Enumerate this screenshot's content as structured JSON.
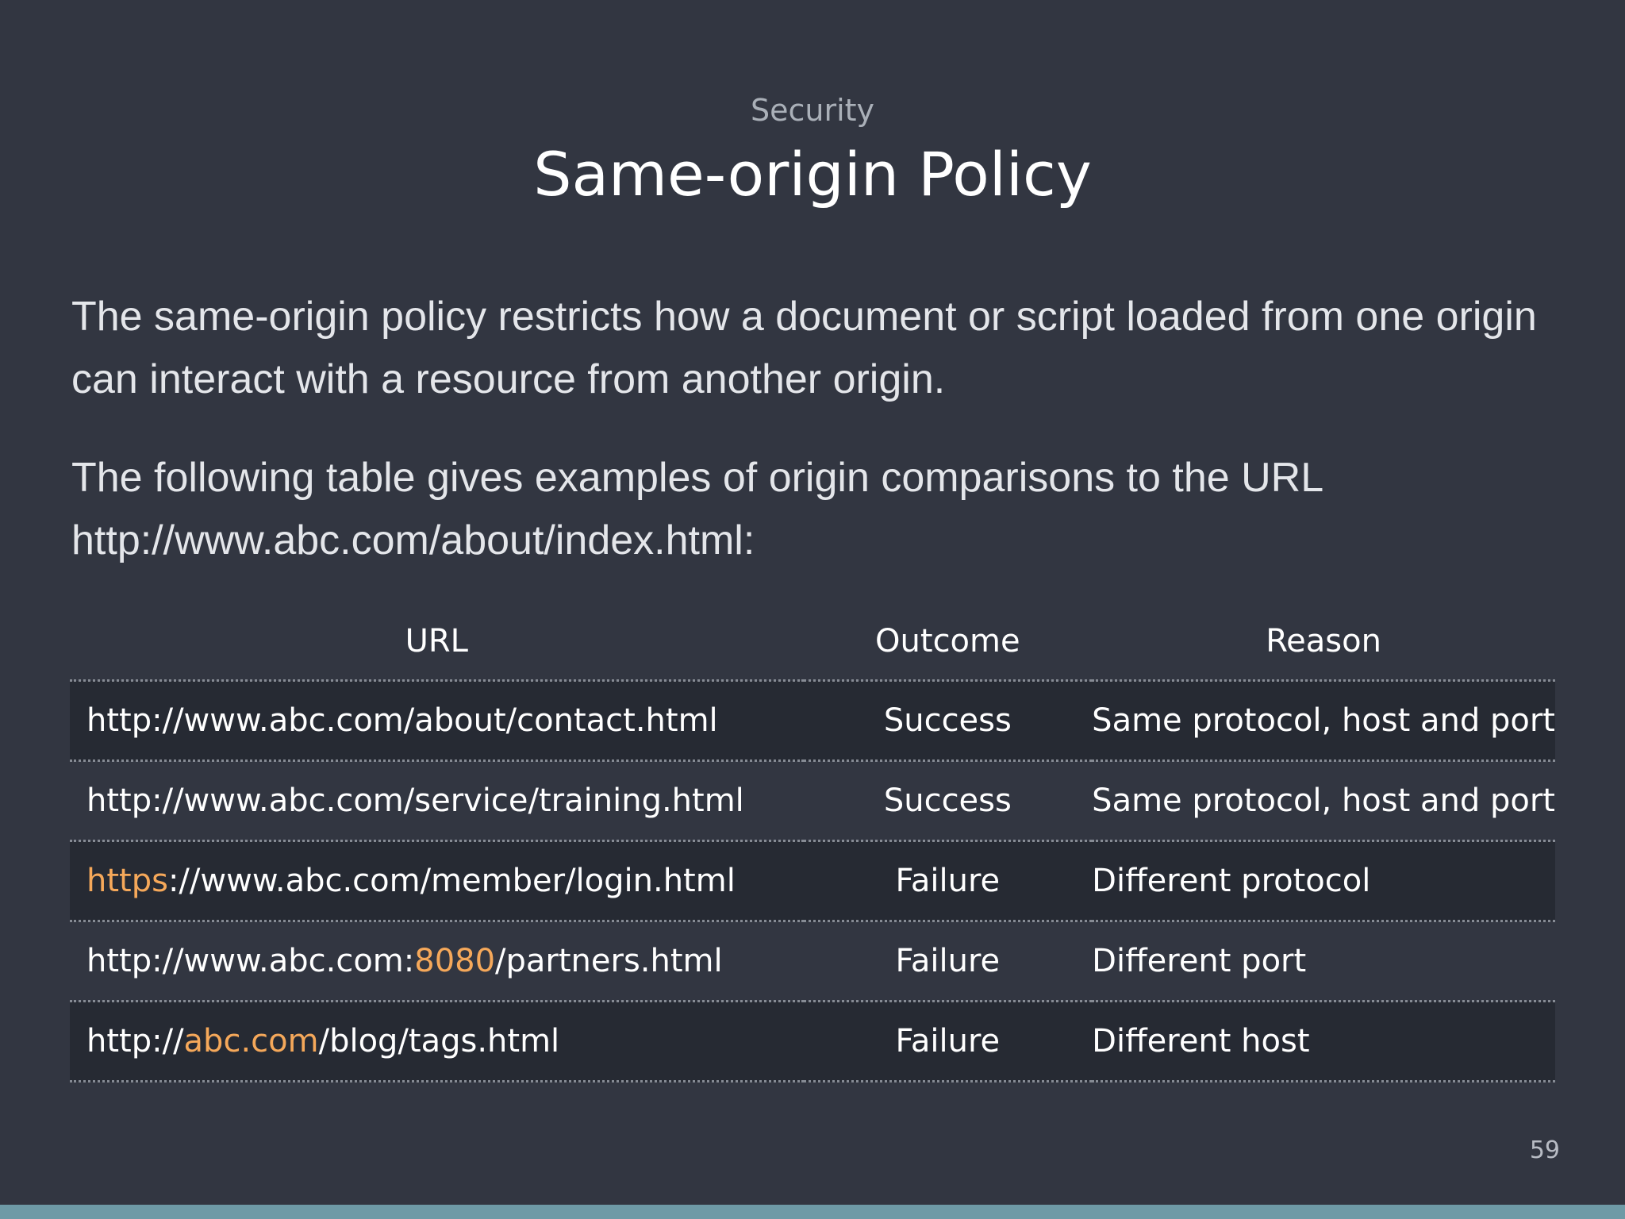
{
  "header": {
    "section": "Security",
    "title": "Same-origin Policy"
  },
  "body": {
    "paragraph_1": "The same-origin policy restricts how a document or script loaded from one origin can interact with a resource from another origin.",
    "paragraph_2": "The following table gives examples of origin comparisons to the URL http://www.abc.com/about/index.html:"
  },
  "table": {
    "columns": [
      "URL",
      "Outcome",
      "Reason"
    ],
    "rows": [
      {
        "url_parts": [
          {
            "text": "http://www.abc.com/about/contact.html",
            "highlight": false
          }
        ],
        "outcome": "Success",
        "reason": "Same protocol, host and port"
      },
      {
        "url_parts": [
          {
            "text": "http://www.abc.com/service/training.html",
            "highlight": false
          }
        ],
        "outcome": "Success",
        "reason": "Same protocol, host and port"
      },
      {
        "url_parts": [
          {
            "text": "https",
            "highlight": true
          },
          {
            "text": "://www.abc.com/member/login.html",
            "highlight": false
          }
        ],
        "outcome": "Failure",
        "reason": "Different protocol"
      },
      {
        "url_parts": [
          {
            "text": "http://www.abc.com:",
            "highlight": false
          },
          {
            "text": "8080",
            "highlight": true
          },
          {
            "text": "/partners.html",
            "highlight": false
          }
        ],
        "outcome": "Failure",
        "reason": "Different port"
      },
      {
        "url_parts": [
          {
            "text": "http://",
            "highlight": false
          },
          {
            "text": "abc.com",
            "highlight": true
          },
          {
            "text": "/blog/tags.html",
            "highlight": false
          }
        ],
        "outcome": "Failure",
        "reason": "Different host"
      }
    ]
  },
  "footer": {
    "page_number": "59"
  },
  "colors": {
    "background": "#323641",
    "row_alt": "#262a33",
    "highlight": "#f5a85a",
    "footer_bar": "#6e9aa6"
  }
}
